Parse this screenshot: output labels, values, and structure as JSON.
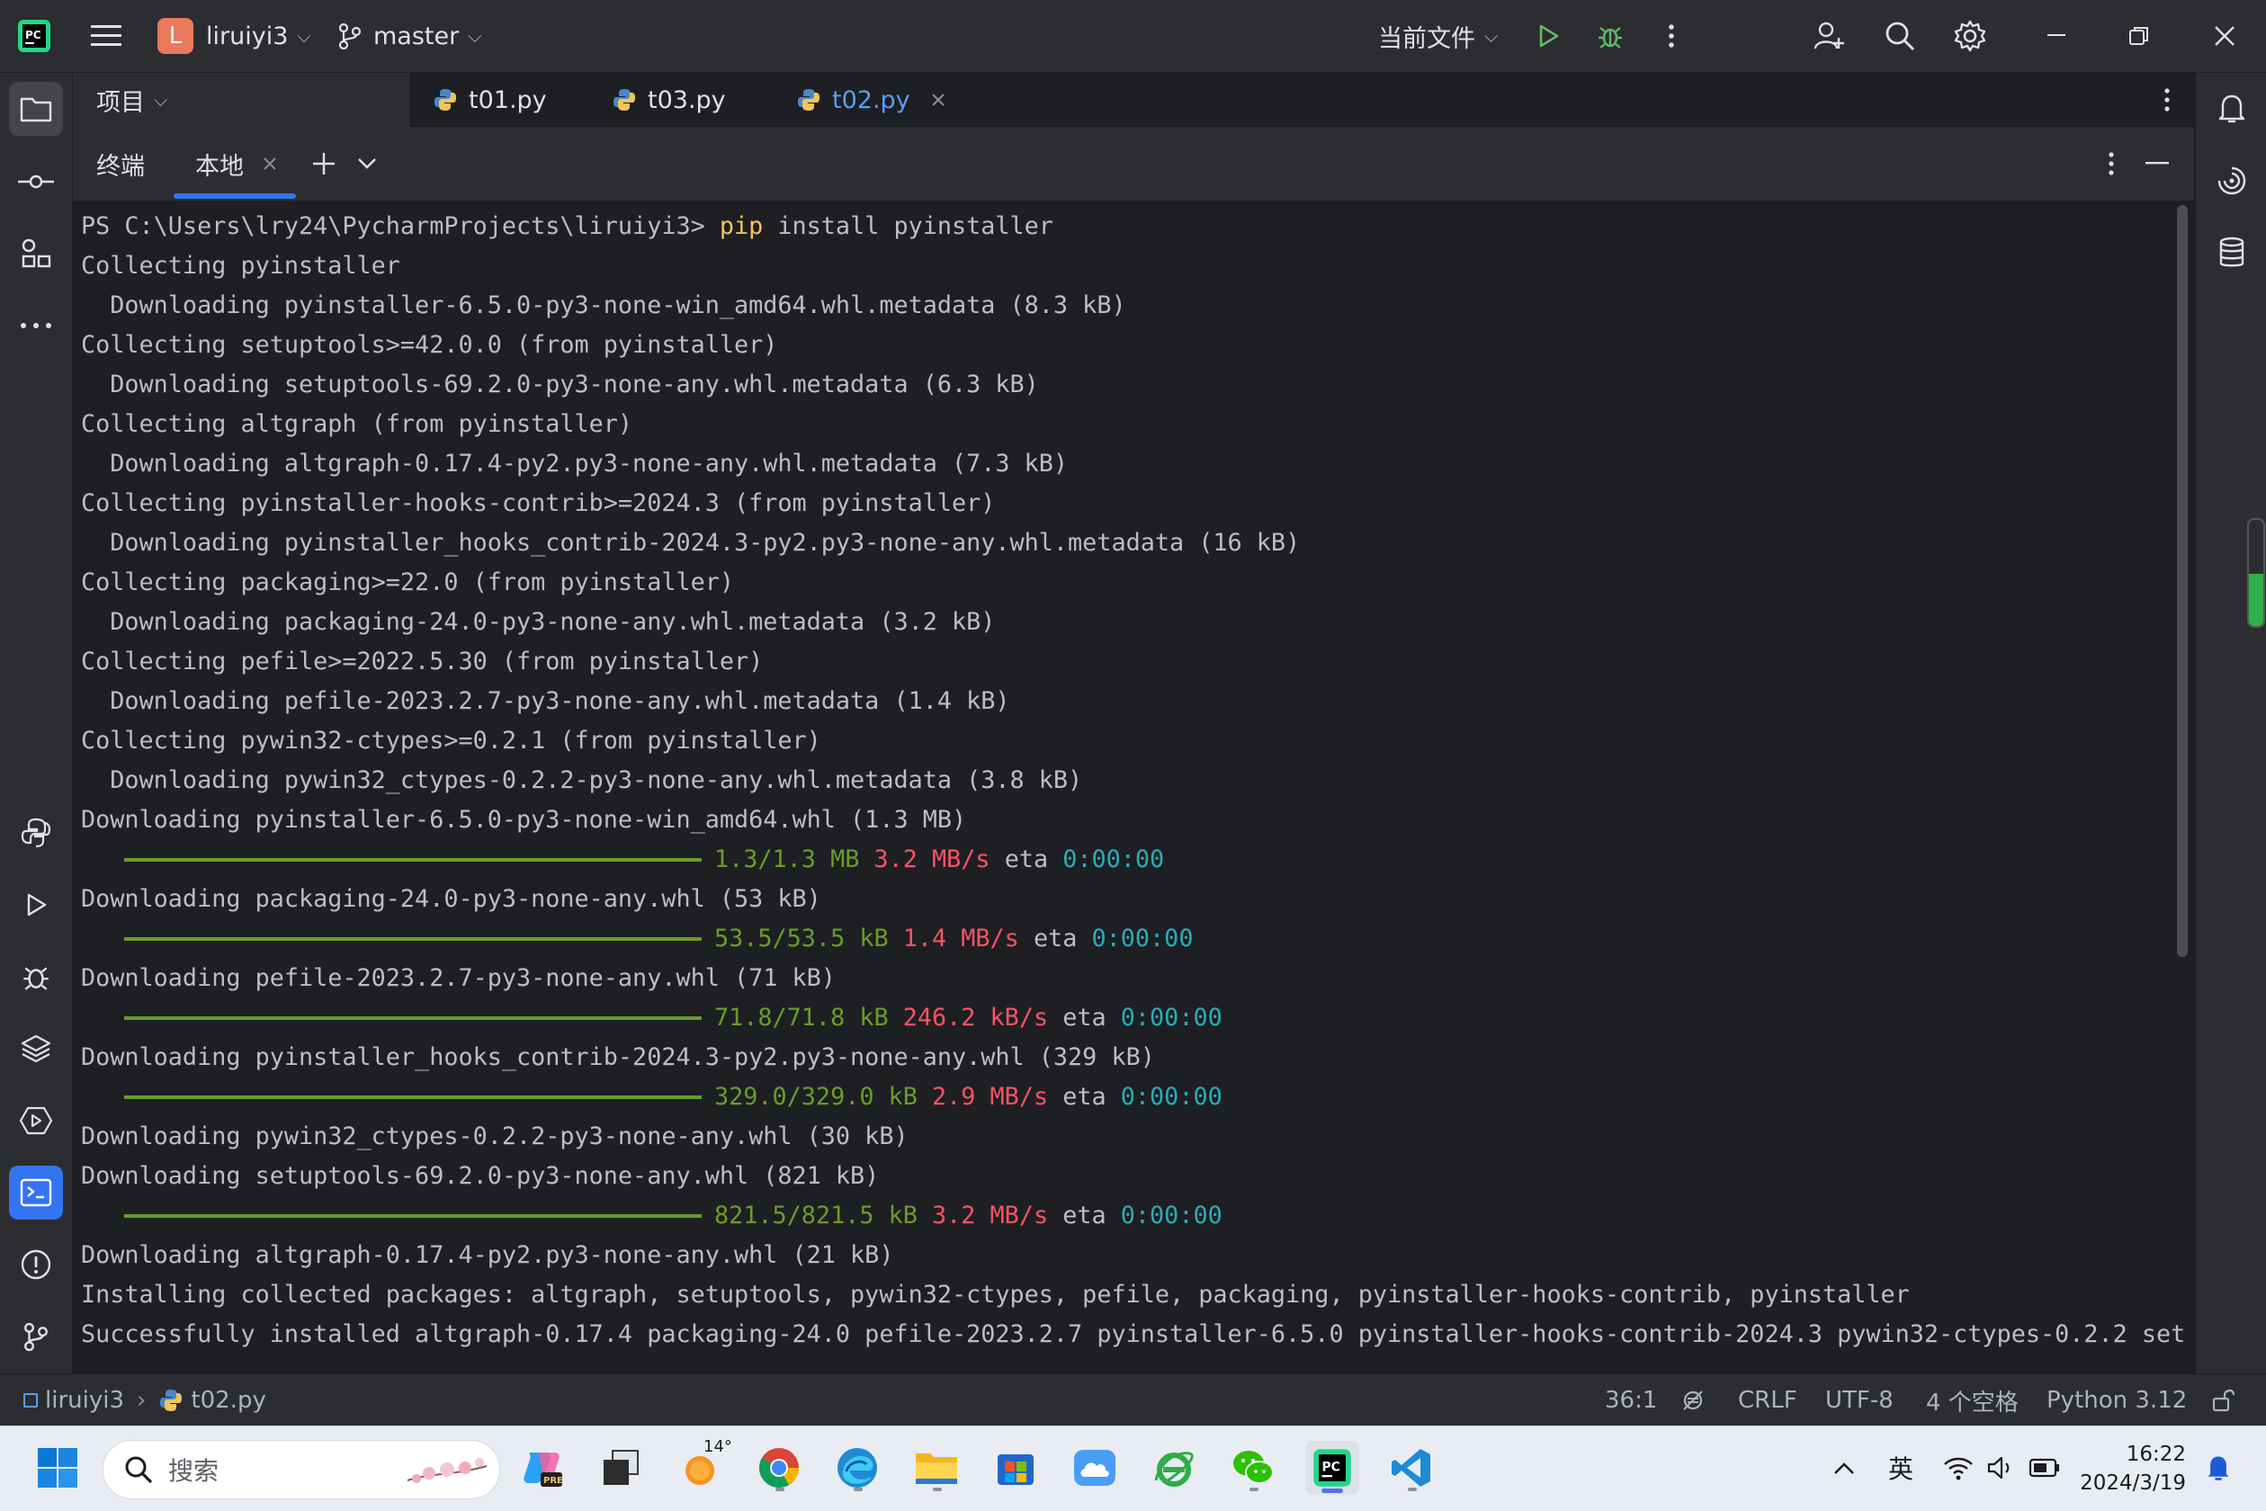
{
  "titlebar": {
    "project_badge": "L",
    "project_name": "liruiyi3",
    "branch": "master",
    "run_config": "当前文件"
  },
  "editor_tabs": {
    "project_label": "项目",
    "tabs": [
      {
        "label": "t01.py"
      },
      {
        "label": "t03.py"
      },
      {
        "label": "t02.py"
      }
    ]
  },
  "terminal": {
    "title": "终端",
    "tab_local": "本地",
    "lines": [
      {
        "text": "PS C:\\Users\\lry24\\PycharmProjects\\liruiyi3> ",
        "cmd": "pip",
        "rest": " install pyinstaller"
      },
      {
        "text": "Collecting pyinstaller"
      },
      {
        "text": "  Downloading pyinstaller-6.5.0-py3-none-win_amd64.whl.metadata (8.3 kB)"
      },
      {
        "text": "Collecting setuptools>=42.0.0 (from pyinstaller)"
      },
      {
        "text": "  Downloading setuptools-69.2.0-py3-none-any.whl.metadata (6.3 kB)"
      },
      {
        "text": "Collecting altgraph (from pyinstaller)"
      },
      {
        "text": "  Downloading altgraph-0.17.4-py2.py3-none-any.whl.metadata (7.3 kB)"
      },
      {
        "text": "Collecting pyinstaller-hooks-contrib>=2024.3 (from pyinstaller)"
      },
      {
        "text": "  Downloading pyinstaller_hooks_contrib-2024.3-py2.py3-none-any.whl.metadata (16 kB)"
      },
      {
        "text": "Collecting packaging>=22.0 (from pyinstaller)"
      },
      {
        "text": "  Downloading packaging-24.0-py3-none-any.whl.metadata (3.2 kB)"
      },
      {
        "text": "Collecting pefile>=2022.5.30 (from pyinstaller)"
      },
      {
        "text": "  Downloading pefile-2023.2.7-py3-none-any.whl.metadata (1.4 kB)"
      },
      {
        "text": "Collecting pywin32-ctypes>=0.2.1 (from pyinstaller)"
      },
      {
        "text": "  Downloading pywin32_ctypes-0.2.2-py3-none-any.whl.metadata (3.8 kB)"
      },
      {
        "text": "Downloading pyinstaller-6.5.0-py3-none-win_amd64.whl (1.3 MB)"
      },
      {
        "progress": {
          "size": "1.3/1.3 MB",
          "speed": "3.2 MB/s",
          "eta_label": "eta",
          "eta": "0:00:00"
        }
      },
      {
        "text": "Downloading packaging-24.0-py3-none-any.whl (53 kB)"
      },
      {
        "progress": {
          "size": "53.5/53.5 kB",
          "speed": "1.4 MB/s",
          "eta_label": "eta",
          "eta": "0:00:00"
        }
      },
      {
        "text": "Downloading pefile-2023.2.7-py3-none-any.whl (71 kB)"
      },
      {
        "progress": {
          "size": "71.8/71.8 kB",
          "speed": "246.2 kB/s",
          "eta_label": "eta",
          "eta": "0:00:00"
        }
      },
      {
        "text": "Downloading pyinstaller_hooks_contrib-2024.3-py2.py3-none-any.whl (329 kB)"
      },
      {
        "progress": {
          "size": "329.0/329.0 kB",
          "speed": "2.9 MB/s",
          "eta_label": "eta",
          "eta": "0:00:00"
        }
      },
      {
        "text": "Downloading pywin32_ctypes-0.2.2-py3-none-any.whl (30 kB)"
      },
      {
        "text": "Downloading setuptools-69.2.0-py3-none-any.whl (821 kB)"
      },
      {
        "progress": {
          "size": "821.5/821.5 kB",
          "speed": "3.2 MB/s",
          "eta_label": "eta",
          "eta": "0:00:00"
        }
      },
      {
        "text": "Downloading altgraph-0.17.4-py2.py3-none-any.whl (21 kB)"
      },
      {
        "text": "Installing collected packages: altgraph, setuptools, pywin32-ctypes, pefile, packaging, pyinstaller-hooks-contrib, pyinstaller"
      },
      {
        "text": "Successfully installed altgraph-0.17.4 packaging-24.0 pefile-2023.2.7 pyinstaller-6.5.0 pyinstaller-hooks-contrib-2024.3 pywin32-ctypes-0.2.2 set"
      }
    ]
  },
  "statusbar": {
    "breadcrumb_project": "liruiyi3",
    "breadcrumb_file": "t02.py",
    "position": "36:1",
    "line_ending": "CRLF",
    "encoding": "UTF-8",
    "indent": "4 个空格",
    "interpreter": "Python 3.12"
  },
  "taskbar": {
    "search_placeholder": "搜索",
    "weather_temp": "14°",
    "ime": "英",
    "time": "16:22",
    "date": "2024/3/19"
  },
  "colors": {
    "accent_blue": "#3574f0",
    "progress_green": "#6a9c2b",
    "speed_red": "#f75464",
    "eta_cyan": "#2aacb8",
    "command_yellow": "#f2c55c"
  },
  "icons": {
    "titlebar": [
      "pycharm-logo-icon",
      "hamburger-menu-icon",
      "branch-icon",
      "run-icon",
      "debug-icon",
      "more-vertical-icon",
      "add-user-icon",
      "search-icon",
      "settings-icon",
      "minimize-icon",
      "restore-icon",
      "close-icon"
    ],
    "left_strip": [
      "folder-icon",
      "commit-icon",
      "structure-icon",
      "more-icon",
      "python-console-icon",
      "run-icon",
      "debug-icon",
      "layers-icon",
      "services-icon",
      "terminal-icon",
      "problems-icon",
      "git-icon"
    ],
    "right_strip": [
      "notifications-icon",
      "ai-assistant-icon",
      "database-icon"
    ]
  }
}
